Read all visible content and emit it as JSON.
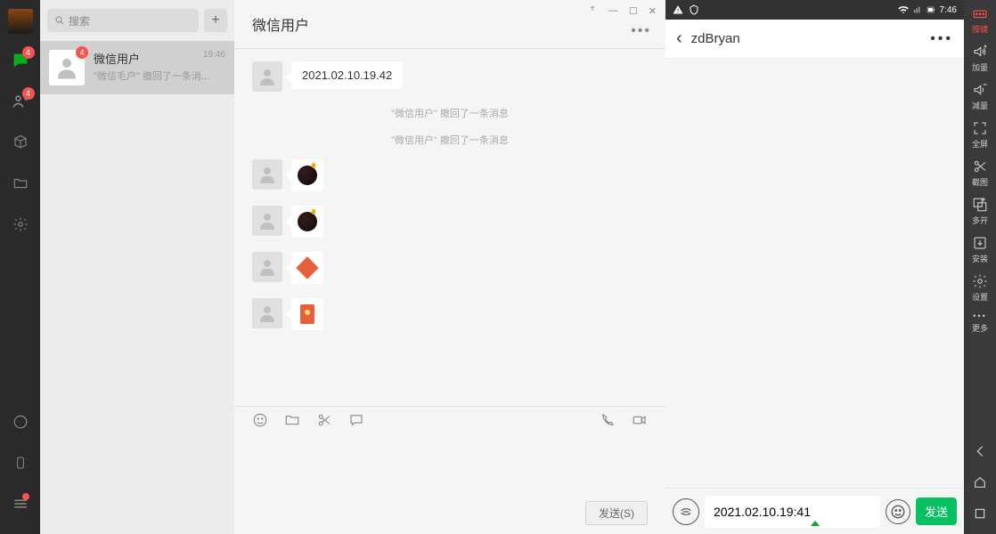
{
  "sidebar": {
    "chat_badge": "4",
    "contacts_badge": "4"
  },
  "search": {
    "placeholder": "搜索"
  },
  "chatlist": {
    "items": [
      {
        "name": "微信用户",
        "preview": "\"微信毛户\" 撤回了一条消...",
        "time": "19:46",
        "badge": "4"
      }
    ]
  },
  "chat": {
    "title": "微信用户",
    "messages": {
      "m0": {
        "text": "2021.02.10.19.42"
      }
    },
    "system": {
      "s0": "\"微信用户\" 撤回了一条消息",
      "s1": "\"微信用户\" 撤回了一条消息"
    },
    "send_label": "发送(S)"
  },
  "phone": {
    "status_time": "7:46",
    "title": "zdBryan",
    "input_value": "2021.02.10.19:41",
    "send_label": "发送"
  },
  "emu": {
    "keys": "按键",
    "vol_up": "加量",
    "vol_down": "减量",
    "fullscreen": "全屏",
    "screenshot": "截图",
    "multi": "多开",
    "install": "安装",
    "settings": "设置",
    "more": "更多"
  }
}
